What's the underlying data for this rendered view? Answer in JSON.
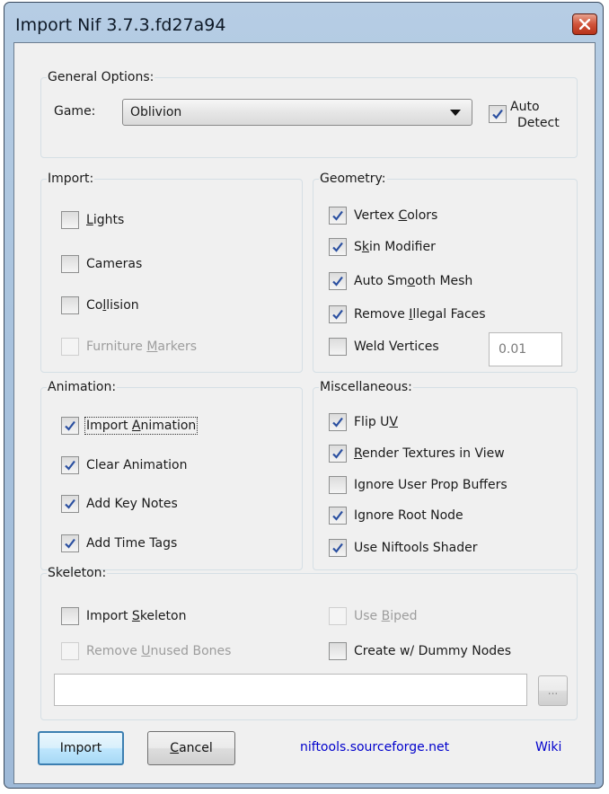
{
  "window": {
    "title": "Import Nif 3.7.3.fd27a94"
  },
  "general": {
    "legend": "General Options:",
    "game_label": "Game:",
    "game_value": "Oblivion",
    "auto_detect_line1": "Auto",
    "auto_detect_line2": "Detect",
    "auto_detect_checked": true
  },
  "import": {
    "legend": "Import:",
    "lights": {
      "pre": "",
      "ul": "L",
      "post": "ights",
      "checked": false
    },
    "cameras": {
      "pre": "",
      "ul": "",
      "post": "Cameras",
      "checked": false
    },
    "collision": {
      "pre": "Co",
      "ul": "l",
      "post": "lision",
      "checked": false
    },
    "furniture": {
      "pre": "Furniture ",
      "ul": "M",
      "post": "arkers",
      "checked": false,
      "disabled": true
    }
  },
  "geometry": {
    "legend": "Geometry:",
    "vertex_colors": {
      "pre": "Vertex ",
      "ul": "C",
      "post": "olors",
      "checked": true
    },
    "skin_modifier": {
      "pre": "S",
      "ul": "k",
      "post": "in Modifier",
      "checked": true
    },
    "auto_smooth": {
      "pre": "Auto Sm",
      "ul": "o",
      "post": "oth Mesh",
      "checked": true
    },
    "remove_illegal": {
      "pre": "Remove ",
      "ul": "I",
      "post": "llegal Faces",
      "checked": true
    },
    "weld_vertices": {
      "pre": "Weld Vertices",
      "ul": "",
      "post": "",
      "checked": false
    },
    "weld_value": "0.01"
  },
  "animation": {
    "legend": "Animation:",
    "import_animation": {
      "pre": "Import ",
      "ul": "A",
      "post": "nimation",
      "checked": true
    },
    "clear_animation": {
      "pre": "Clear Animation",
      "ul": "",
      "post": "",
      "checked": true
    },
    "add_key_notes": {
      "pre": "Add Key Notes",
      "ul": "",
      "post": "",
      "checked": true
    },
    "add_time_tags": {
      "pre": "Add Time Tags",
      "ul": "",
      "post": "",
      "checked": true
    }
  },
  "misc": {
    "legend": "Miscellaneous:",
    "flip_uv": {
      "pre": "Flip U",
      "ul": "V",
      "post": "",
      "checked": true
    },
    "render_textures": {
      "pre": "",
      "ul": "R",
      "post": "ender Textures in View",
      "checked": true
    },
    "ignore_user_prop": {
      "pre": "Ignore User Prop Buffers",
      "ul": "",
      "post": "",
      "checked": false
    },
    "ignore_root": {
      "pre": "Ignore Root Node",
      "ul": "",
      "post": "",
      "checked": true
    },
    "use_niftools_shader": {
      "pre": "Use Niftools Shader",
      "ul": "",
      "post": "",
      "checked": true
    }
  },
  "skeleton": {
    "legend": "Skeleton:",
    "import_skeleton": {
      "pre": "Import ",
      "ul": "S",
      "post": "keleton",
      "checked": false
    },
    "use_biped": {
      "pre": "Use ",
      "ul": "B",
      "post": "iped",
      "checked": false,
      "disabled": true
    },
    "remove_unused": {
      "pre": "Remove ",
      "ul": "U",
      "post": "nused Bones",
      "checked": false,
      "disabled": true
    },
    "create_dummy": {
      "pre": "Create w/ Dummy Nodes",
      "ul": "",
      "post": "",
      "checked": false
    },
    "path_value": "",
    "browse_label": "..."
  },
  "footer": {
    "import_label": "Import",
    "cancel_pre": "",
    "cancel_ul": "C",
    "cancel_post": "ancel",
    "link": "niftools.sourceforge.net",
    "wiki": "Wiki"
  },
  "icons": {
    "check": "check-icon",
    "close": "close-icon",
    "dropdown": "dropdown-arrow-icon"
  },
  "colors": {
    "titlebar": "#a9c3de",
    "close_button": "#c94a32",
    "default_button_border": "#3c7fb1",
    "link": "#0000cc"
  }
}
